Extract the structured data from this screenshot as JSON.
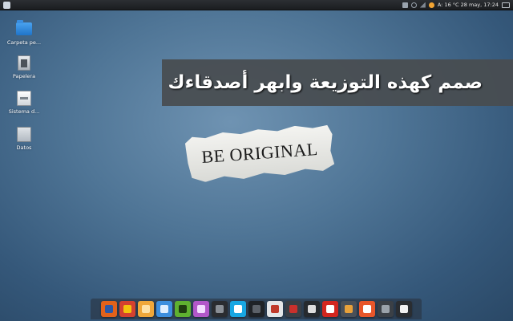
{
  "top_panel": {
    "tray_text": "A: 16 °C  28 may, 17:24"
  },
  "desktop": {
    "icons": [
      {
        "label": "Carpeta pe...",
        "icon": "folder-icon"
      },
      {
        "label": "Papelera",
        "icon": "trash-icon"
      },
      {
        "label": "Sistema d...",
        "icon": "drive-icon"
      },
      {
        "label": "Datos",
        "icon": "drive-icon"
      }
    ]
  },
  "banner": {
    "text": "صمم كهذه التوزيعة وابهر أصدقاءك"
  },
  "wallpaper": {
    "slogan": "BE ORIGINAL"
  },
  "dock": {
    "items": [
      {
        "name": "firefox-icon",
        "color": "#e2621b",
        "inner": "#2a58a8"
      },
      {
        "name": "chrome-icon",
        "color": "#d4412f",
        "inner": "#f4c20d"
      },
      {
        "name": "files-icon",
        "color": "#f0a73a",
        "inner": "#ffe2a8"
      },
      {
        "name": "mail-icon",
        "color": "#3c8ede",
        "inner": "#dfeeff"
      },
      {
        "name": "spotify-icon",
        "color": "#5fb130",
        "inner": "#1f3d10"
      },
      {
        "name": "chat-icon",
        "color": "#b257c9",
        "inner": "#f3dcff"
      },
      {
        "name": "camera-icon",
        "color": "#2a2c30",
        "inner": "#8a8f96"
      },
      {
        "name": "skype-icon",
        "color": "#18a6e2",
        "inner": "#ffffff"
      },
      {
        "name": "webcam-icon",
        "color": "#1f2226",
        "inner": "#5c6168"
      },
      {
        "name": "document-icon",
        "color": "#e4e6e8",
        "inner": "#c03a2b"
      },
      {
        "name": "video-editor-icon",
        "color": "#3a3f45",
        "inner": "#c9302c"
      },
      {
        "name": "media-player-icon",
        "color": "#262a2e",
        "inner": "#dddddd"
      },
      {
        "name": "youtube-icon",
        "color": "#d3261f",
        "inner": "#ffffff"
      },
      {
        "name": "calculator-icon",
        "color": "#4a5058",
        "inner": "#e8a13a"
      },
      {
        "name": "software-center-icon",
        "color": "#e8562a",
        "inner": "#ffffff"
      },
      {
        "name": "monitor-icon",
        "color": "#3b4046",
        "inner": "#9aa2aa"
      },
      {
        "name": "terminal-icon",
        "color": "#2a2d31",
        "inner": "#f1f1f1"
      }
    ]
  }
}
